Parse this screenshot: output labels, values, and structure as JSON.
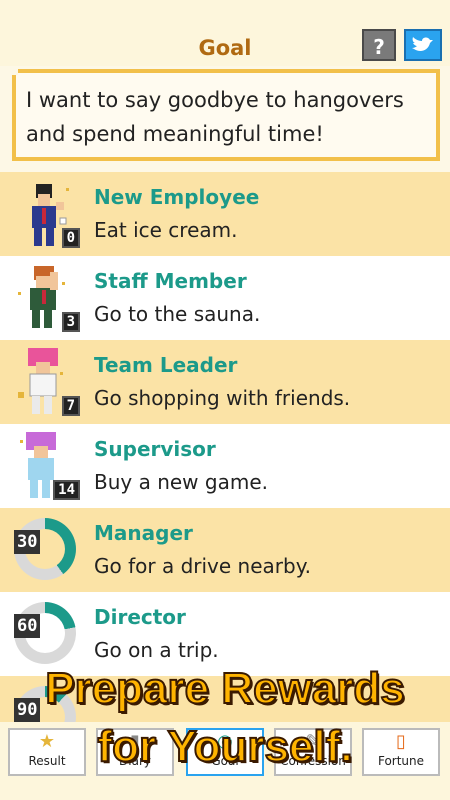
{
  "header": {
    "title": "Goal",
    "help_label": "?"
  },
  "goal": {
    "text": "I want to say goodbye to hangovers and spend meaningful time!"
  },
  "rewards": [
    {
      "rank": "New Employee",
      "task": "Eat ice cream.",
      "count": "0"
    },
    {
      "rank": "Staff Member",
      "task": "Go to the sauna.",
      "count": "3"
    },
    {
      "rank": "Team Leader",
      "task": "Go shopping with friends.",
      "count": "7"
    },
    {
      "rank": "Supervisor",
      "task": "Buy a new game.",
      "count": "14"
    },
    {
      "rank": "Manager",
      "task": "Go for a drive nearby.",
      "count": "30"
    },
    {
      "rank": "Director",
      "task": "Go on a trip.",
      "count": "60"
    },
    {
      "count": "90"
    }
  ],
  "promo": {
    "line1": "Prepare Rewards",
    "line2": "for Yourself."
  },
  "nav": [
    "Result",
    "Diary",
    "Goal",
    "Confession",
    "Fortune"
  ],
  "colors": {
    "accent": "#1c9a8a",
    "title": "#b06a12",
    "row_yellow": "#fbe3a6"
  }
}
